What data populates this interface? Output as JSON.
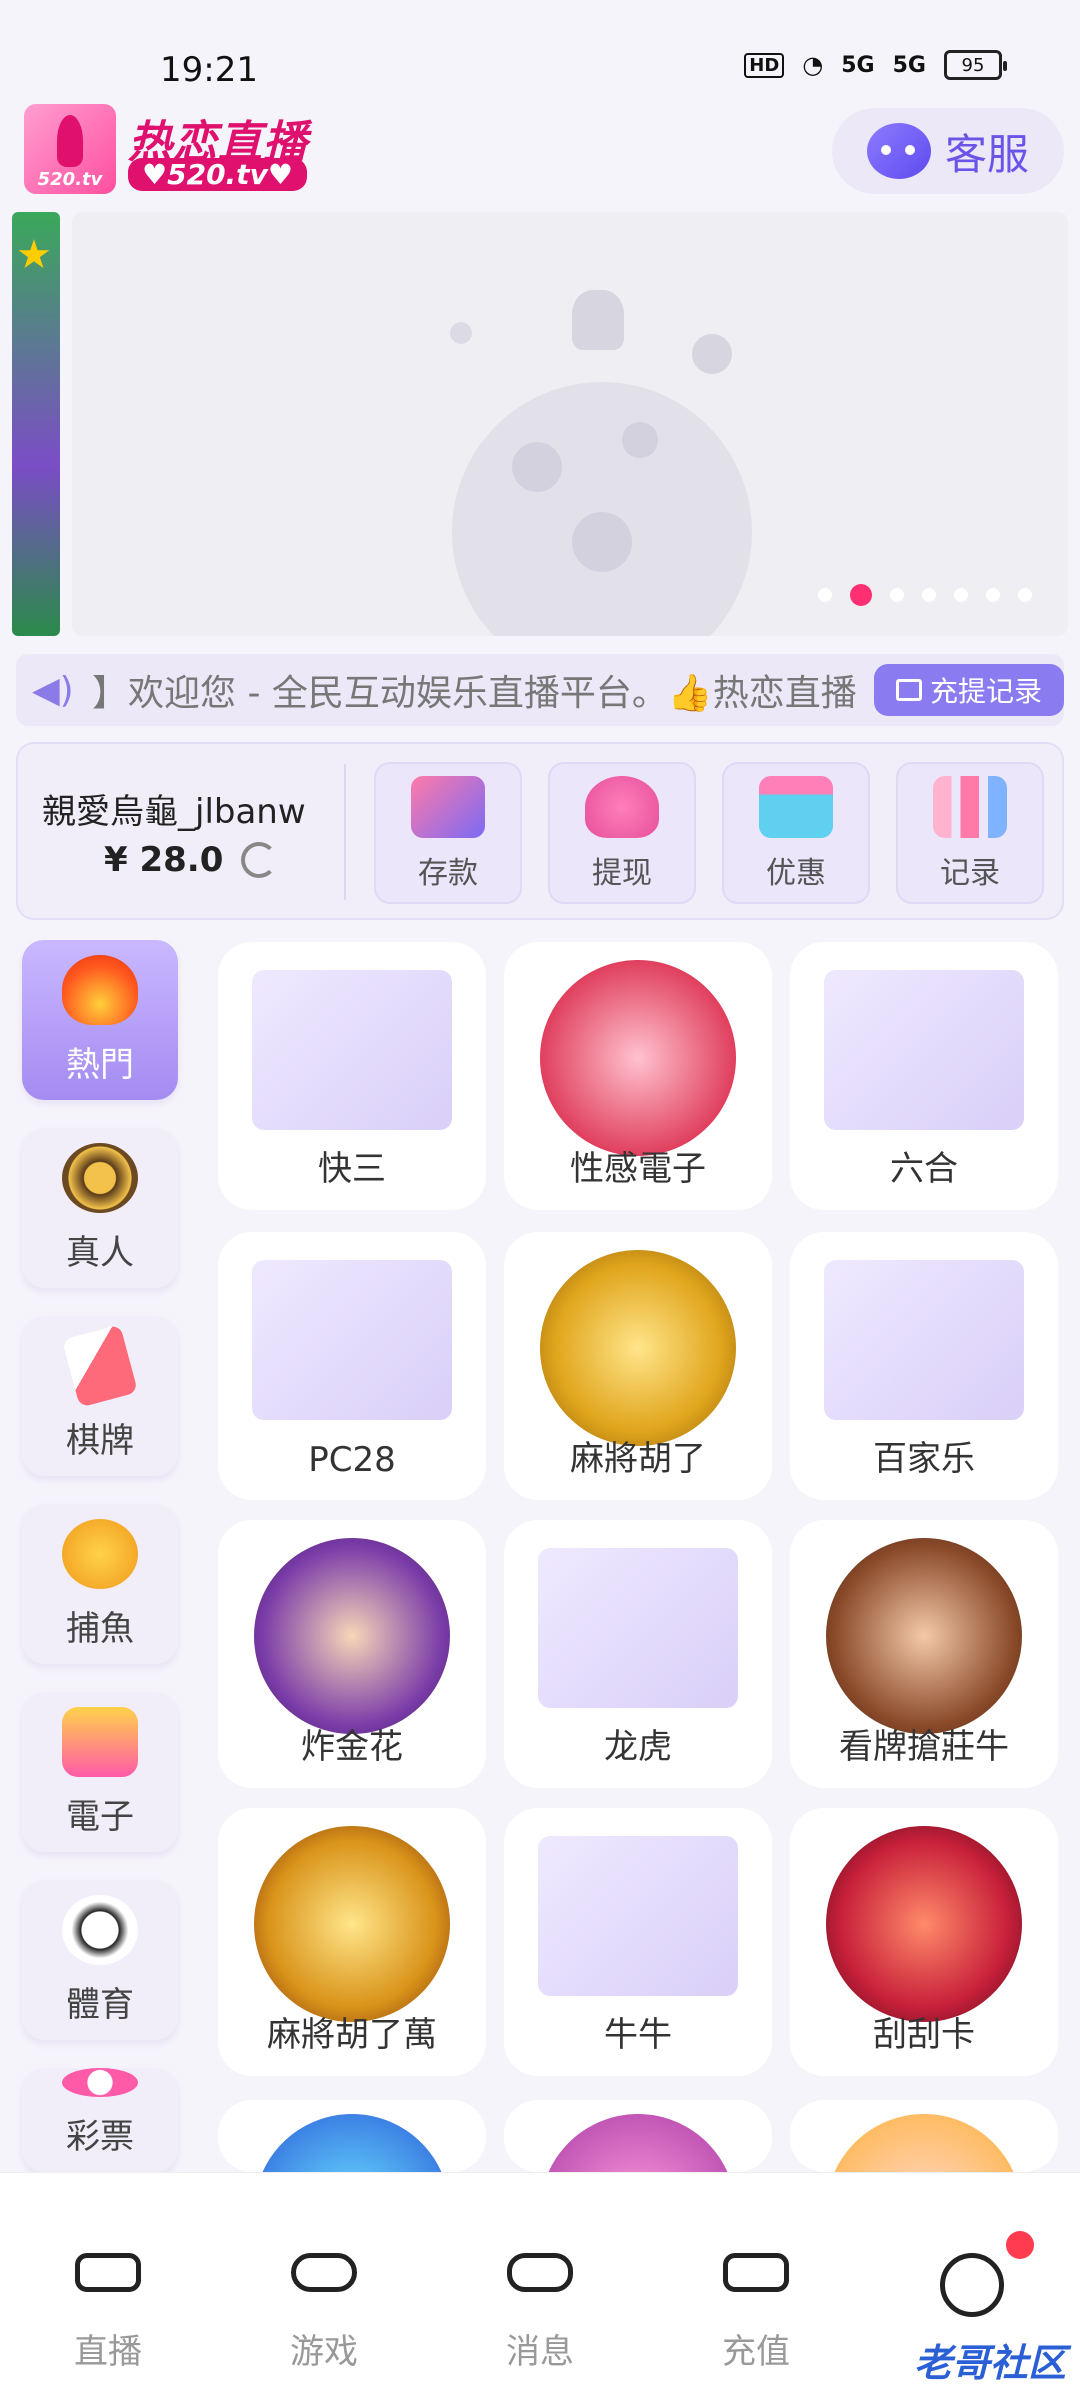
{
  "status_bar": {
    "time": "19:21",
    "hd": "HD",
    "net1": "5G",
    "net2": "5G",
    "battery": "95"
  },
  "header": {
    "logo_text": "520.tv",
    "brand_name": "热恋直播",
    "brand_url": "♥520.tv♥",
    "service_label": "客服"
  },
  "marquee": {
    "text": "】欢迎您 - 全民互动娱乐直播平台。👍热恋直播",
    "records_label": "充提记录"
  },
  "account": {
    "username": "親愛烏龜_jlbanw",
    "balance": "¥ 28.0",
    "actions": [
      {
        "label": "存款",
        "icon": "card-icon"
      },
      {
        "label": "提现",
        "icon": "money-bag-icon"
      },
      {
        "label": "优惠",
        "icon": "gift-icon"
      },
      {
        "label": "记录",
        "icon": "bar-chart-icon"
      }
    ]
  },
  "categories": [
    {
      "label": "熱門",
      "icon": "flame-icon"
    },
    {
      "label": "真人",
      "icon": "chip-icon"
    },
    {
      "label": "棋牌",
      "icon": "cards-icon"
    },
    {
      "label": "捕魚",
      "icon": "fish-icon"
    },
    {
      "label": "電子",
      "icon": "slot-icon"
    },
    {
      "label": "體育",
      "icon": "soccer-icon"
    },
    {
      "label": "彩票",
      "icon": "lottery-ball-icon"
    }
  ],
  "games": [
    {
      "label": "快三"
    },
    {
      "label": "性感電子"
    },
    {
      "label": "六合"
    },
    {
      "label": "PC28"
    },
    {
      "label": "麻將胡了"
    },
    {
      "label": "百家乐"
    },
    {
      "label": "炸金花"
    },
    {
      "label": "龙虎"
    },
    {
      "label": "看牌搶莊牛"
    },
    {
      "label": "麻將胡了萬"
    },
    {
      "label": "牛牛"
    },
    {
      "label": "刮刮卡"
    }
  ],
  "nav": [
    {
      "label": "直播",
      "icon": "camera-icon"
    },
    {
      "label": "游戏",
      "icon": "gamepad-icon"
    },
    {
      "label": "消息",
      "icon": "chat-icon"
    },
    {
      "label": "充值",
      "icon": "wallet-icon"
    },
    {
      "label": "",
      "icon": "smile-icon"
    }
  ],
  "watermark": "老哥社区",
  "colors": {
    "accent": "#8b7bf0",
    "brand": "#e0106f",
    "badge": "#ff3b4f"
  }
}
